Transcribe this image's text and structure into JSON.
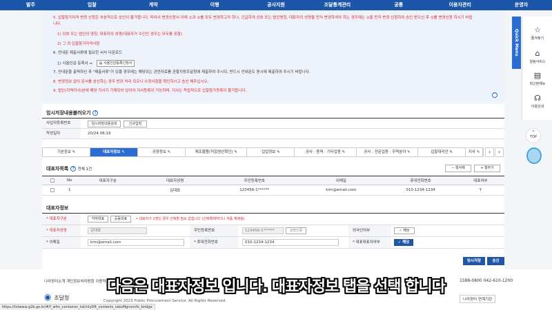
{
  "nav": [
    "발주",
    "입찰",
    "계약",
    "이행",
    "공사지원",
    "조달통계관리",
    "공통",
    "이용자관리",
    "운영자"
  ],
  "notice": {
    "l5": "5. 입찰참가자격 변경 신청은 부분적으로 승인이 불가합니다. 따라서 변경신청서 아래 ①과 ②를 모두 변경하고자 하나, 긴급하게 상호 또는 법인명칭, 대표자의 성명을 먼저 변경하여야 하는 경우에는 ①을 먼저 변경 신청하여 승인 받으신 후 ②를 변경신청 하시기 바랍",
    "l5b": "니다.",
    "l5_1": "1) 상호 또는 법인의 명칭, 대표자의 성명(대표자가 수인인 경우는 모두를 포함)",
    "l5_2": "2) 그 외 입찰참가자격사항",
    "l6": "6. 안내문 제출서류에 필요한 서식 다운로드",
    "l6_1": "1) 사용인감 등록서 ⇒",
    "l6_btn": "사용인감등록신청서",
    "l7": "7. 안내문을 출력하신 후 \"제출서류\"가 있을 경우에는 해당되는 관련자료를 관할지방조달청에 제출하여 주시되, 반드시 안내문도 동시에 제출하여 주시기 바랍니다.",
    "l8": "8. 변경정보 없이 문서를 송신하는 경우 반려 처리 되오니 수정사항을 확인하시고 송신 해주십시오.",
    "l9": "9. 법인(지역지사)본에 해당 지사가 기재되어 있어야 지사등록이 가능하며, 지사는 독립적으로 입찰참가등록이 불가합니다.",
    "collapse": "^"
  },
  "main": {
    "temp_title": "임시저장내용불러오기",
    "biz_no_label": "사업자등록번호",
    "btn_temp_search": "임시저장내용검색",
    "btn_new": "신규입력",
    "date_label": "작성일자",
    "date_value": "20/24 08:19",
    "tabs": [
      "기본정보 ✎",
      "대표자정보 ✎",
      "공장정보 ✎",
      "제조물품(직접생산확인) ✎",
      "업업정보 ✎",
      "공사 · 용역 · 기타업종 ✎",
      "공사 : 전문업종 · 주력분야 ✎",
      "입찰대리인 ✎",
      "지사 ✎"
    ],
    "prev": "‹",
    "next": "›",
    "list_title": "대표자목록",
    "list_count": "전체 1건",
    "btn_delete": "− 행삭제",
    "btn_add": "+ 행추가",
    "cols": [
      "No",
      "대표자구분",
      "대표자성명",
      "주민등록번호",
      "이메일",
      "휴대전화번호",
      "대표여부"
    ],
    "rows": [
      {
        "no": "1",
        "type": "",
        "name": "김대표",
        "rrn": "123456-1******",
        "email": "kim@email.com",
        "phone": "010-1234-1234",
        "rep": "Y"
      }
    ],
    "detail_title": "대표자정보",
    "type_label": "* 대표자구분",
    "btn_each": "각자대표",
    "btn_joint": "공동대표",
    "type_note": "• 대표자가 1명인 경우 선택할 필요 없습니다 (선택해제하더니 자동 해제됨)",
    "name_label": "* 대표자성명",
    "name_value": "김대표",
    "rrn_label": "주민등록번호",
    "rrn_value": "123456-1******",
    "btn_verify": "실명인증",
    "foreign_label": "외국인여부",
    "foreign_value": "✓ 해당",
    "email_label": "* 이메일",
    "email_value": "kim@email.com",
    "phone_label": "* 휴대전화번호",
    "phone_value": "010-1234-1234",
    "reptype_label": "* 대표대표자여부",
    "reptype_value": "✓ 해당",
    "btn_save": "임시저장",
    "btn_send": "송신"
  },
  "footer": {
    "links": "나라장터소개   개인정보처리방침   이용약관",
    "copyright": "Copyright 2023 Public Procurement Service. All Rights Reserved.",
    "phone": "1588-0800   042-610-1200",
    "related": "나라장터 연계기관",
    "logo_text": "조달청"
  },
  "subtitle": "다음은 대표자정보 입니다. 대표자정보 탭을 선택 합니다",
  "status_url": "https://tstwww.g2b.go.kr/#/f_wfm_container_taUntyDft_contents_tabsMgnsnnfo_bridge",
  "quick": {
    "label": "Quick Menu",
    "items": [
      "즐겨찾기",
      "알림서비스",
      "최근본메뉴",
      "이용안내"
    ],
    "top": "TOP"
  }
}
